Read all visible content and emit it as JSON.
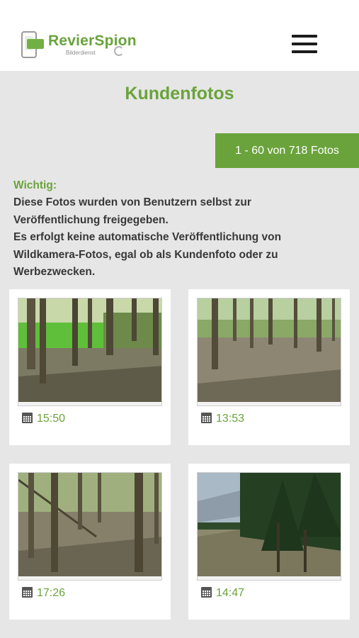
{
  "header": {
    "logo_title": "RevierSpion",
    "logo_subtitle": "Bilderdienst"
  },
  "page": {
    "title": "Kundenfotos",
    "count_label": "1 - 60 von 718 Fotos"
  },
  "notice": {
    "label": "Wichtig:",
    "line1": "Diese Fotos wurden von Benutzern selbst zur",
    "line2": "Veröffentlichung freigegeben.",
    "line3": "Es erfolgt keine automatische Veröffentlichung von",
    "line4": "Wildkamera-Fotos, egal ob als Kundenfoto oder zu",
    "line5": "Werbezwecken."
  },
  "photos": [
    {
      "time": "15:50",
      "scene": "forest with green meadow"
    },
    {
      "time": "13:53",
      "scene": "forest floor with dry leaves"
    },
    {
      "time": "17:26",
      "scene": "young forest with fallen branches"
    },
    {
      "time": "14:47",
      "scene": "spruce forest slope"
    }
  ],
  "colors": {
    "accent": "#6aa33b",
    "background": "#e6e6e6",
    "text": "#383838"
  }
}
